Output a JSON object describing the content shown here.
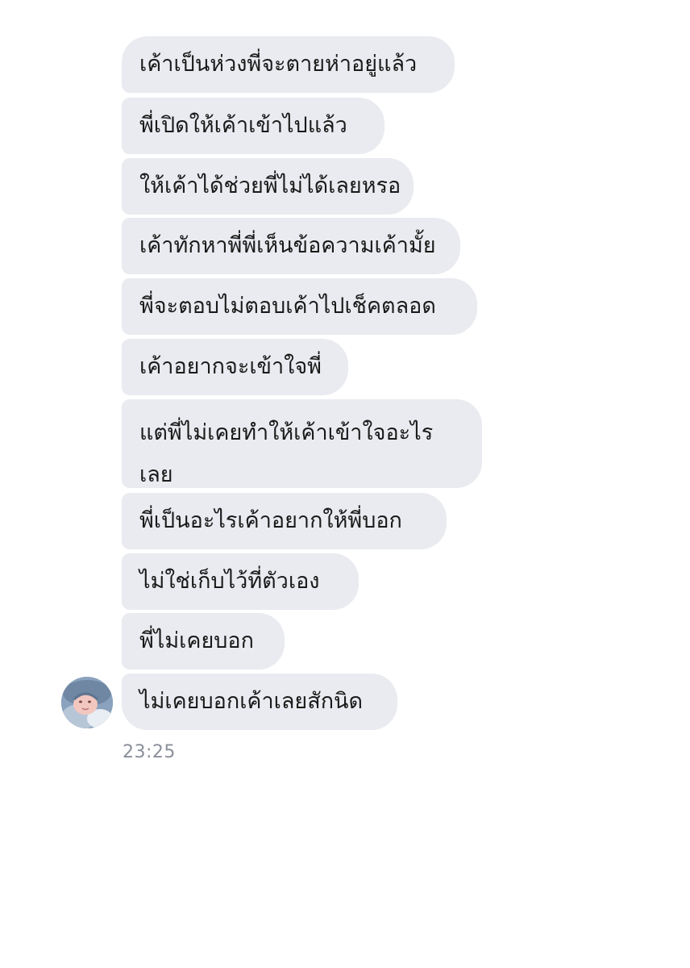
{
  "messages": [
    {
      "text": "เค้าเป็นห่วงพี่จะตายห่าอยู่แล้ว"
    },
    {
      "text": "พี่เปิดให้เค้าเข้าไปแล้ว"
    },
    {
      "text": "ให้เค้าได้ช่วยพี่ไม่ได้เลยหรอ"
    },
    {
      "text": "เค้าทักหาพี่พี่เห็นข้อความเค้ามั้ย"
    },
    {
      "text": "พี่จะตอบไม่ตอบเค้าไปเช็คตลอด"
    },
    {
      "text": "เค้าอยากจะเข้าใจพี่"
    },
    {
      "text": "แต่พี่ไม่เคยทำให้เค้าเข้าใจอะไร เลย"
    },
    {
      "text": "พี่เป็นอะไรเค้าอยากให้พี่บอก"
    },
    {
      "text": "ไม่ใช่เก็บไว้ที่ตัวเอง"
    },
    {
      "text": "พี่ไม่เคยบอก"
    },
    {
      "text": "ไม่เคยบอกเค้าเลยสักนิด"
    }
  ],
  "timestamp": "23:25",
  "colors": {
    "bubble_bg": "#e9ebf0",
    "text": "#1a1a1a",
    "timestamp": "#8a8f99"
  },
  "avatar": {
    "icon": "profile-avatar"
  }
}
